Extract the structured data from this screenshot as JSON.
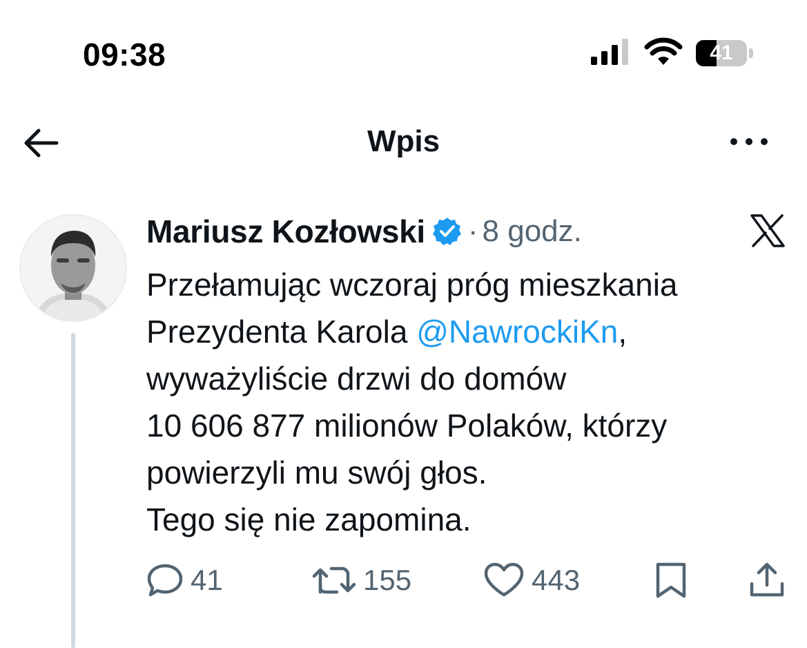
{
  "status_bar": {
    "time": "09:38",
    "battery_level": "41",
    "battery_fraction": 0.41
  },
  "header": {
    "title": "Wpis"
  },
  "post": {
    "author_name": "Mariusz Kozłowski",
    "separator": "·",
    "time_ago": "8 godz.",
    "verified": true,
    "text": {
      "line1": "Przełamując wczoraj próg mieszkania",
      "line2_before": "Prezydenta Karola ",
      "mention": "@NawrockiKn",
      "line2_after": ",",
      "line3": "wyważyliście drzwi do domów",
      "line4": "10 606 877 milionów Polaków, którzy",
      "line5": "powierzyli mu swój głos.",
      "line6": "Tego się nie zapomina."
    },
    "stats": {
      "replies": "41",
      "reposts": "155",
      "likes": "443"
    }
  },
  "icons": [
    "signal-icon",
    "wifi-icon",
    "battery-icon",
    "back-arrow-icon",
    "more-icon",
    "verified-badge-icon",
    "x-logo-icon",
    "reply-icon",
    "repost-icon",
    "like-icon",
    "bookmark-icon",
    "share-icon"
  ],
  "colors": {
    "text": "#0f1419",
    "secondary": "#536471",
    "link": "#1d9bf0",
    "verified": "#1d9bf0",
    "thread_line": "#cfd9de"
  }
}
